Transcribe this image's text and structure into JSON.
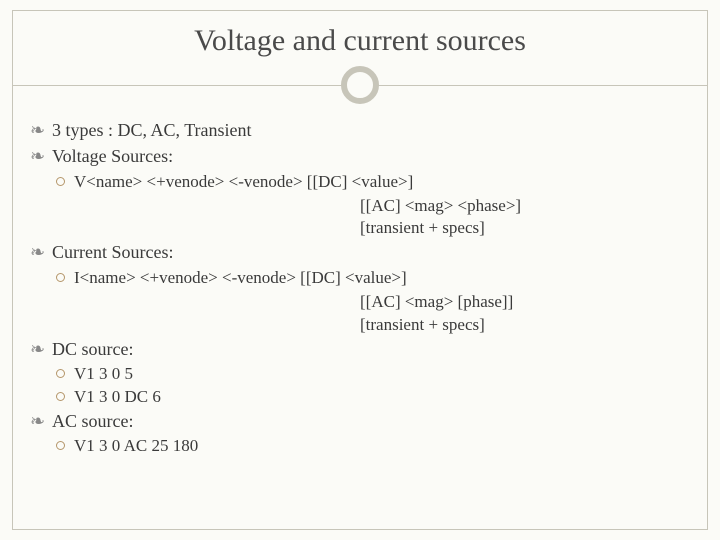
{
  "title": "Voltage and current sources",
  "bullets": {
    "types": "3 types :  DC, AC, Transient",
    "voltage_heading": "Voltage Sources:",
    "voltage_syntax_a": "V<name>   <+venode>     <-venode>   [[DC] <value>]",
    "voltage_syntax_b": "[[AC] <mag> <phase>]",
    "voltage_syntax_c": "[transient + specs]",
    "current_heading": "Current Sources:",
    "current_syntax_a": "I<name>   <+venode>    <-venode>  [[DC] <value>]",
    "current_syntax_b": "[[AC] <mag> [phase]]",
    "current_syntax_c": "[transient + specs]",
    "dc_heading": "DC source:",
    "dc_ex1": "V1  3 0   5",
    "dc_ex2": "V1  3 0  DC   6",
    "ac_heading": "AC source:",
    "ac_ex1": "V1  3 0   AC   25   180"
  },
  "glyphs": {
    "hand": "❧"
  }
}
